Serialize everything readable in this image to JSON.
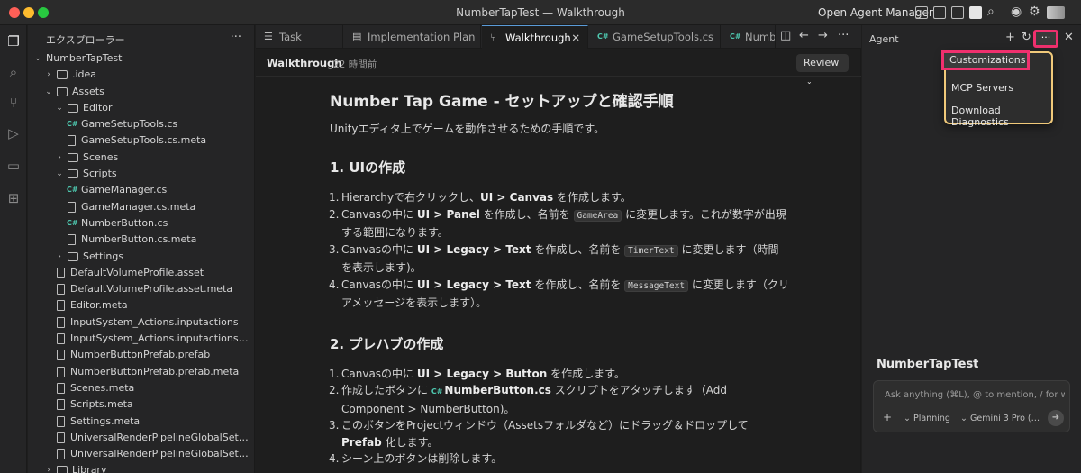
{
  "window": {
    "title": "NumberTapTest — Walkthrough",
    "open_agent_manager": "Open Agent Manager"
  },
  "explorer": {
    "title": "エクスプローラー",
    "more": "···",
    "items": [
      {
        "name": "NumberTapTest",
        "type": "root",
        "depth": 0,
        "expanded": true
      },
      {
        "name": ".idea",
        "type": "folder",
        "depth": 1,
        "expanded": false
      },
      {
        "name": "Assets",
        "type": "folder",
        "depth": 1,
        "expanded": true
      },
      {
        "name": "Editor",
        "type": "folder",
        "depth": 2,
        "expanded": true
      },
      {
        "name": "GameSetupTools.cs",
        "type": "cs",
        "depth": 3
      },
      {
        "name": "GameSetupTools.cs.meta",
        "type": "file",
        "depth": 3
      },
      {
        "name": "Scenes",
        "type": "folder",
        "depth": 2,
        "expanded": false
      },
      {
        "name": "Scripts",
        "type": "folder",
        "depth": 2,
        "expanded": true
      },
      {
        "name": "GameManager.cs",
        "type": "cs",
        "depth": 3
      },
      {
        "name": "GameManager.cs.meta",
        "type": "file",
        "depth": 3
      },
      {
        "name": "NumberButton.cs",
        "type": "cs",
        "depth": 3
      },
      {
        "name": "NumberButton.cs.meta",
        "type": "file",
        "depth": 3
      },
      {
        "name": "Settings",
        "type": "folder",
        "depth": 2,
        "expanded": false
      },
      {
        "name": "DefaultVolumeProfile.asset",
        "type": "file",
        "depth": 2
      },
      {
        "name": "DefaultVolumeProfile.asset.meta",
        "type": "file",
        "depth": 2
      },
      {
        "name": "Editor.meta",
        "type": "file",
        "depth": 2
      },
      {
        "name": "InputSystem_Actions.inputactions",
        "type": "file",
        "depth": 2
      },
      {
        "name": "InputSystem_Actions.inputactions.m...",
        "type": "file",
        "depth": 2
      },
      {
        "name": "NumberButtonPrefab.prefab",
        "type": "file",
        "depth": 2
      },
      {
        "name": "NumberButtonPrefab.prefab.meta",
        "type": "file",
        "depth": 2
      },
      {
        "name": "Scenes.meta",
        "type": "file",
        "depth": 2
      },
      {
        "name": "Scripts.meta",
        "type": "file",
        "depth": 2
      },
      {
        "name": "Settings.meta",
        "type": "file",
        "depth": 2
      },
      {
        "name": "UniversalRenderPipelineGlobalSettin...",
        "type": "file",
        "depth": 2
      },
      {
        "name": "UniversalRenderPipelineGlobalSettin...",
        "type": "file",
        "depth": 2
      },
      {
        "name": "Library",
        "type": "folder",
        "depth": 1,
        "expanded": false
      }
    ]
  },
  "tabs": [
    {
      "label": "Task",
      "icon": "list-icon"
    },
    {
      "label": "Implementation Plan",
      "icon": "doc-icon"
    },
    {
      "label": "Walkthrough",
      "icon": "branch-icon",
      "active": true
    },
    {
      "label": "GameSetupTools.cs",
      "icon": "cs-icon"
    },
    {
      "label": "Numbe",
      "icon": "cs-icon"
    }
  ],
  "cs_badge": "C#",
  "subbar": {
    "title": "Walkthrough",
    "time": "22 時間前",
    "review": "Review"
  },
  "doc": {
    "title": "Number Tap Game - セットアップと確認手順",
    "lead": "Unityエディタ上でゲームを動作させるための手順です。",
    "sec1": {
      "heading": "1. UIの作成",
      "i1": {
        "n": "1.",
        "a": "Hierarchyで右クリックし、",
        "b": "UI > Canvas",
        "c": " を作成します。"
      },
      "i2": {
        "n": "2.",
        "a": "Canvasの中に ",
        "b": "UI > Panel",
        "c": " を作成し、名前を ",
        "code": "GameArea",
        "d": " に変更します。これが数字が出現する範囲になります。"
      },
      "i3": {
        "n": "3.",
        "a": "Canvasの中に ",
        "b": "UI > Legacy > Text",
        "c": " を作成し、名前を ",
        "code": "TimerText",
        "d": " に変更します（時間を表示します)。"
      },
      "i4": {
        "n": "4.",
        "a": "Canvasの中に ",
        "b": "UI > Legacy > Text",
        "c": " を作成し、名前を ",
        "code": "MessageText",
        "d": " に変更します（クリアメッセージを表示します）。"
      }
    },
    "sec2": {
      "heading": "2. プレハブの作成",
      "i1": {
        "n": "1.",
        "a": "Canvasの中に ",
        "b": "UI > Legacy > Button",
        "c": " を作成します。"
      },
      "i2": {
        "n": "2.",
        "a": "作成したボタンに ",
        "b": "NumberButton.cs",
        "c": " スクリプトをアタッチします（Add Component > NumberButton)。"
      },
      "i3": {
        "n": "3.",
        "a": "このボタンをProjectウィンドウ（Assetsフォルダなど）にドラッグ＆ドロップして ",
        "b": "Prefab",
        "c": " 化します。"
      },
      "i4": {
        "n": "4.",
        "a": "シーン上のボタンは削除します。"
      }
    }
  },
  "agent": {
    "title": "Agent",
    "more": "···",
    "menu": [
      "Customizations",
      "MCP Servers",
      "Download Diagnostics"
    ],
    "project": "NumberTapTest",
    "placeholder": "Ask anything (⌘L), @ to mention, / for wor",
    "plus": "+",
    "mode": "Planning",
    "model": "Gemini 3 Pro (…"
  }
}
